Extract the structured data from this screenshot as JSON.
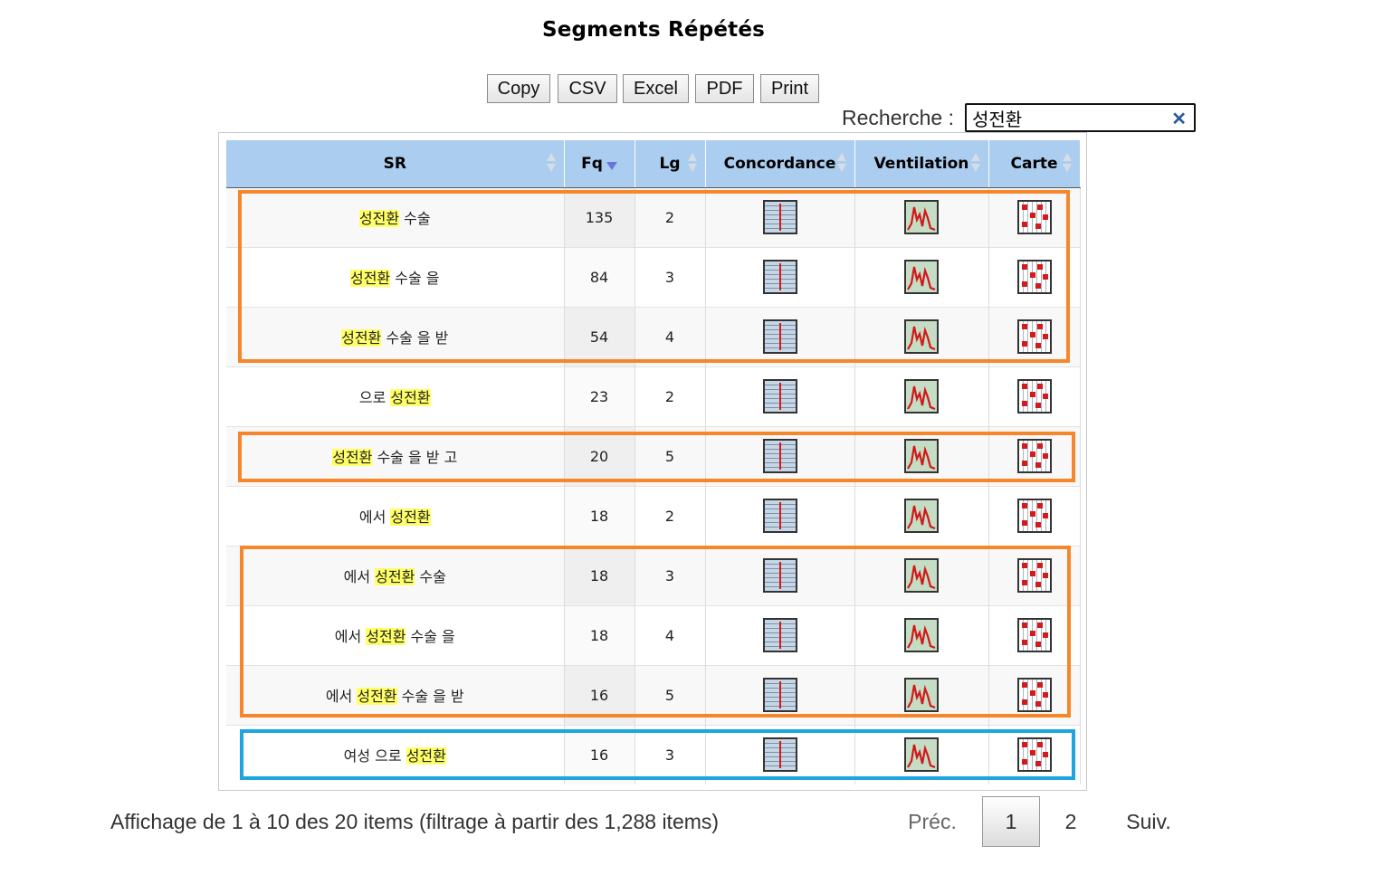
{
  "title": "Segments Répétés",
  "buttons": [
    {
      "label": "Copy"
    },
    {
      "label": "CSV"
    },
    {
      "label": "Excel"
    },
    {
      "label": "PDF"
    },
    {
      "label": "Print"
    }
  ],
  "search": {
    "label": "Recherche :",
    "value": "성전환",
    "clear_icon": "close-icon"
  },
  "table": {
    "columns": [
      "SR",
      "Fq",
      "Lg",
      "Concordance",
      "Ventilation",
      "Carte"
    ],
    "sort_column": "Fq",
    "sort_direction": "descending",
    "rows": [
      {
        "sr": [
          {
            "t": "성전환",
            "hl": true
          },
          {
            "t": " 수술",
            "hl": false
          }
        ],
        "fq": "135",
        "lg": "2"
      },
      {
        "sr": [
          {
            "t": "성전환",
            "hl": true
          },
          {
            "t": " 수술 을",
            "hl": false
          }
        ],
        "fq": "84",
        "lg": "3"
      },
      {
        "sr": [
          {
            "t": "성전환",
            "hl": true
          },
          {
            "t": " 수술 을 받",
            "hl": false
          }
        ],
        "fq": "54",
        "lg": "4"
      },
      {
        "sr": [
          {
            "t": "으로 ",
            "hl": false
          },
          {
            "t": "성전환",
            "hl": true
          }
        ],
        "fq": "23",
        "lg": "2"
      },
      {
        "sr": [
          {
            "t": "성전환",
            "hl": true
          },
          {
            "t": " 수술 을 받 고",
            "hl": false
          }
        ],
        "fq": "20",
        "lg": "5"
      },
      {
        "sr": [
          {
            "t": "에서 ",
            "hl": false
          },
          {
            "t": "성전환",
            "hl": true
          }
        ],
        "fq": "18",
        "lg": "2"
      },
      {
        "sr": [
          {
            "t": "에서 ",
            "hl": false
          },
          {
            "t": "성전환",
            "hl": true
          },
          {
            "t": " 수술",
            "hl": false
          }
        ],
        "fq": "18",
        "lg": "3"
      },
      {
        "sr": [
          {
            "t": "에서 ",
            "hl": false
          },
          {
            "t": "성전환",
            "hl": true
          },
          {
            "t": " 수술 을",
            "hl": false
          }
        ],
        "fq": "18",
        "lg": "4"
      },
      {
        "sr": [
          {
            "t": "에서 ",
            "hl": false
          },
          {
            "t": "성전환",
            "hl": true
          },
          {
            "t": " 수술 을 받",
            "hl": false
          }
        ],
        "fq": "16",
        "lg": "5"
      },
      {
        "sr": [
          {
            "t": "여성 으로 ",
            "hl": false
          },
          {
            "t": "성전환",
            "hl": true
          }
        ],
        "fq": "16",
        "lg": "3"
      }
    ],
    "row_icons": [
      "concordance-icon",
      "ventilation-icon",
      "carte-icon"
    ]
  },
  "annotations": {
    "orange_color": "#f5862a",
    "blue_color": "#1ea4e0",
    "groups": [
      {
        "color": "orange",
        "rows": [
          1,
          3
        ]
      },
      {
        "color": "orange",
        "rows": [
          5,
          5
        ]
      },
      {
        "color": "orange",
        "rows": [
          7,
          9
        ]
      },
      {
        "color": "blue",
        "rows": [
          10,
          10
        ]
      }
    ]
  },
  "info": "Affichage de 1 à 10 des 20 items (filtrage à partir des 1,288 items)",
  "pagination": {
    "prev": "Préc.",
    "pages": [
      "1",
      "2"
    ],
    "current_page": "1",
    "next": "Suiv."
  }
}
